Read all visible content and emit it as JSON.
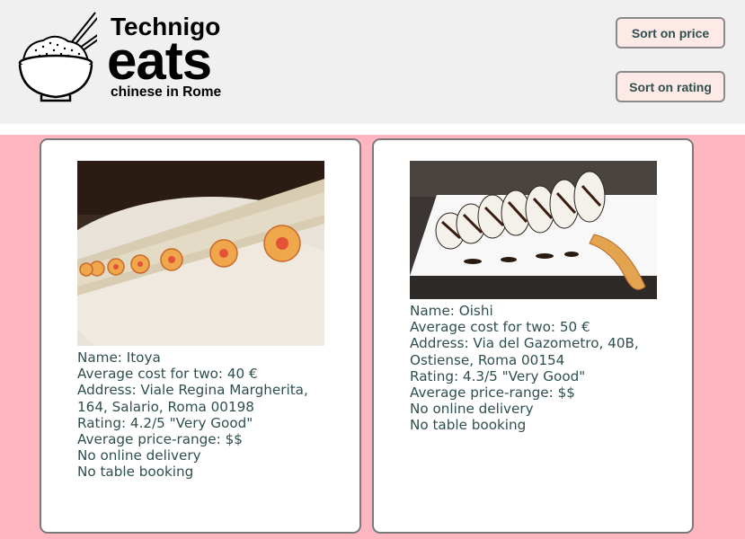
{
  "brand": {
    "line1": "Technigo",
    "line2": "eats",
    "line3": "chinese in Rome"
  },
  "controls": {
    "sort_price": "Sort on price",
    "sort_rating": "Sort on rating"
  },
  "restaurants": [
    {
      "name": "Name: Itoya",
      "cost": "Average cost for two: 40 €",
      "address": "Address: Viale Regina Margherita, 164, Salario, Roma 00198",
      "rating": "Rating: 4.2/5 \"Very Good\"",
      "price_range": "Average price-range: $$",
      "delivery": "No online delivery",
      "booking": "No table booking"
    },
    {
      "name": "Name: Oishi",
      "cost": "Average cost for two: 50 €",
      "address": "Address: Via del Gazometro, 40B, Ostiense, Roma 00154",
      "rating": "Rating: 4.3/5 \"Very Good\"",
      "price_range": "Average price-range: $$",
      "delivery": "No online delivery",
      "booking": "No table booking"
    }
  ]
}
